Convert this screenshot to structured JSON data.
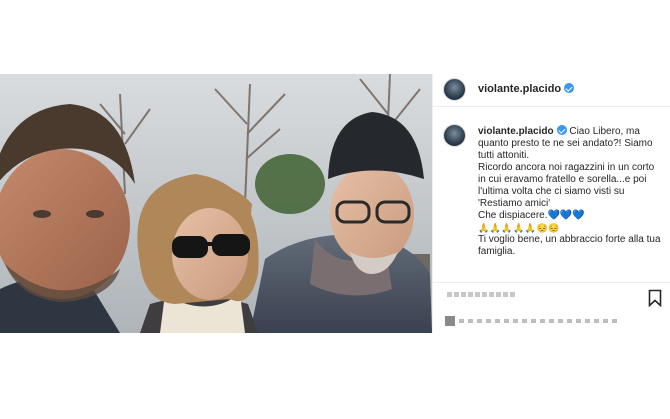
{
  "post": {
    "username": "violante.placido",
    "caption_lines": [
      "Ciao Libero, ma quanto presto te ne sei andato?! Siamo tutti attoniti.",
      "Ricordo ancora noi ragazzini in un corto in cui eravamo fratello e sorella...e poi l'ultima volta che ci siamo visti su 'Restiamo amici'",
      "Che dispiacere."
    ],
    "hearts": "💙💙💙",
    "emoji_line": "🙏🙏🙏🙏🙏😔😔",
    "closing": "Ti voglio bene, un abbraccio forte alla tua famiglia."
  },
  "colors": {
    "verified": "#3897f0",
    "username": "#262626",
    "border": "#efefef"
  },
  "icons": [
    "verified-badge-icon",
    "bookmark-icon",
    "avatar"
  ]
}
